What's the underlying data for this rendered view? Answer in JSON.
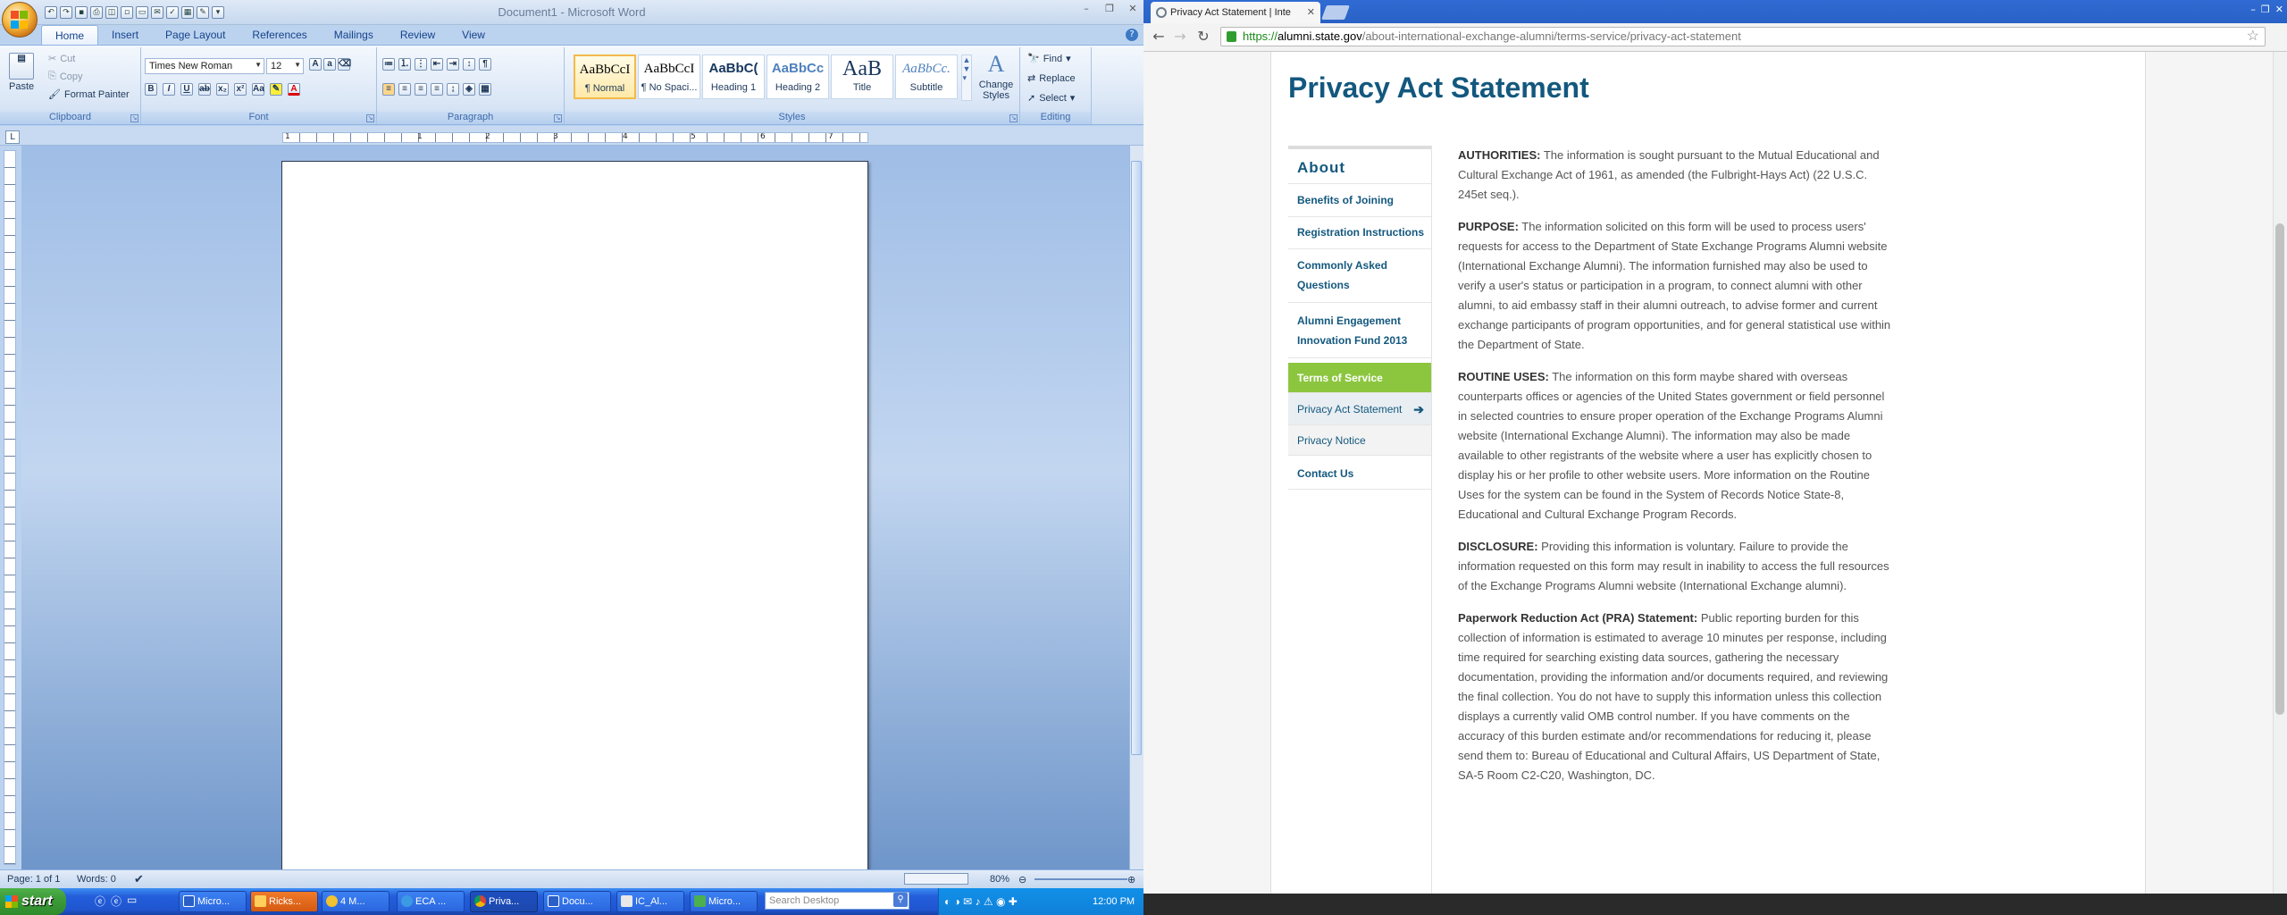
{
  "word": {
    "window_title": "Document1 - Microsoft Word",
    "tabs": [
      "Home",
      "Insert",
      "Page Layout",
      "References",
      "Mailings",
      "Review",
      "View"
    ],
    "clipboard": {
      "paste": "Paste",
      "cut": "Cut",
      "copy": "Copy",
      "format_painter": "Format Painter",
      "label": "Clipboard"
    },
    "font": {
      "name": "Times New Roman",
      "size": "12",
      "label": "Font"
    },
    "paragraph": {
      "label": "Paragraph"
    },
    "styles": {
      "label": "Styles",
      "items": [
        {
          "preview": "AaBbCcI",
          "name": "¶ Normal"
        },
        {
          "preview": "AaBbCcI",
          "name": "¶ No Spaci..."
        },
        {
          "preview": "AaBbC(",
          "name": "Heading 1"
        },
        {
          "preview": "AaBbCc",
          "name": "Heading 2"
        },
        {
          "preview": "AaB",
          "name": "Title"
        },
        {
          "preview": "AaBbCc.",
          "name": "Subtitle"
        }
      ],
      "change_styles": "Change Styles"
    },
    "editing": {
      "find": "Find",
      "replace": "Replace",
      "select": "Select",
      "label": "Editing"
    },
    "ruler_numbers": [
      "1",
      "1",
      "2",
      "3",
      "4",
      "5",
      "6",
      "7"
    ],
    "status": {
      "page": "Page: 1 of 1",
      "words": "Words: 0",
      "zoom": "80%"
    }
  },
  "taskbar": {
    "start": "start",
    "items": [
      {
        "label": "Micro...",
        "color": "#1f5fd6"
      },
      {
        "label": "Ricks...",
        "color": "#e06a1a"
      },
      {
        "label": "4 M...",
        "color": "#1f5fd6"
      },
      {
        "label": "ECA ...",
        "color": "#1f5fd6"
      },
      {
        "label": "Priva...",
        "color": "#1f5fd6"
      },
      {
        "label": "Docu...",
        "color": "#1f5fd6"
      },
      {
        "label": "IC_Al...",
        "color": "#1f5fd6"
      },
      {
        "label": "Micro...",
        "color": "#1f5fd6"
      }
    ],
    "search_placeholder": "Search Desktop",
    "clock": "12:00 PM"
  },
  "browser": {
    "tab_title": "Privacy Act Statement | Inte",
    "url_scheme": "https://",
    "url_host": "alumni.state.gov",
    "url_path": "/about-international-exchange-alumni/terms-service/privacy-act-statement",
    "page_title": "Privacy Act Statement",
    "sidebar": {
      "heading": "About",
      "items": [
        {
          "label": "Benefits of Joining"
        },
        {
          "label": "Registration Instructions"
        },
        {
          "label": "Commonly Asked Questions"
        },
        {
          "label": "Alumni Engagement Innovation Fund 2013"
        },
        {
          "label": "Terms of Service"
        },
        {
          "label": "Privacy Act Statement"
        },
        {
          "label": "Privacy Notice"
        },
        {
          "label": "Contact Us"
        }
      ]
    },
    "paragraphs": [
      {
        "head": "AUTHORITIES:",
        "text": " The information is sought pursuant to the Mutual Educational and Cultural Exchange Act of 1961, as amended (the Fulbright-Hays Act) (22 U.S.C. 245et seq.)."
      },
      {
        "head": "PURPOSE:",
        "text": " The information solicited on this form will be used to process users' requests for access to the Department of State Exchange Programs Alumni website (International Exchange Alumni). The information furnished may also be used to verify a user's status or participation in a program, to connect alumni with other alumni, to aid embassy staff in their alumni outreach, to advise former and current exchange participants of program opportunities, and for general statistical use within the Department of State."
      },
      {
        "head": "ROUTINE USES:",
        "text": " The information on this form maybe shared with overseas counterparts offices or agencies of the United States government or field personnel in selected countries to ensure proper operation of the Exchange Programs Alumni website (International Exchange Alumni). The information may also be made available to other registrants of the website where a user has explicitly chosen to display his or her profile to other website users. More information on the Routine Uses for the system can be found in the System of Records Notice State-8, Educational and Cultural Exchange Program Records."
      },
      {
        "head": "DISCLOSURE:",
        "text": " Providing this information is voluntary. Failure to provide the information requested on this form may result in inability to access the full resources of the Exchange Programs Alumni website (International Exchange alumni)."
      },
      {
        "head": "Paperwork Reduction Act (PRA) Statement:",
        "text": " Public reporting burden for this collection of information is estimated to average 10 minutes per response, including time required for searching existing data sources, gathering the necessary documentation, providing the information and/or documents required, and reviewing the final collection. You do not have to supply this information unless this collection displays a currently valid OMB control number. If you have comments on the accuracy of this burden estimate and/or recommendations for reducing it, please send them to: Bureau of Educational and Cultural Affairs, US Department of State, SA-5 Room C2-C20, Washington, DC."
      }
    ]
  },
  "colors": {
    "site_blue": "#13587e",
    "site_green": "#8cc63f",
    "word_blue": "#15428b"
  }
}
